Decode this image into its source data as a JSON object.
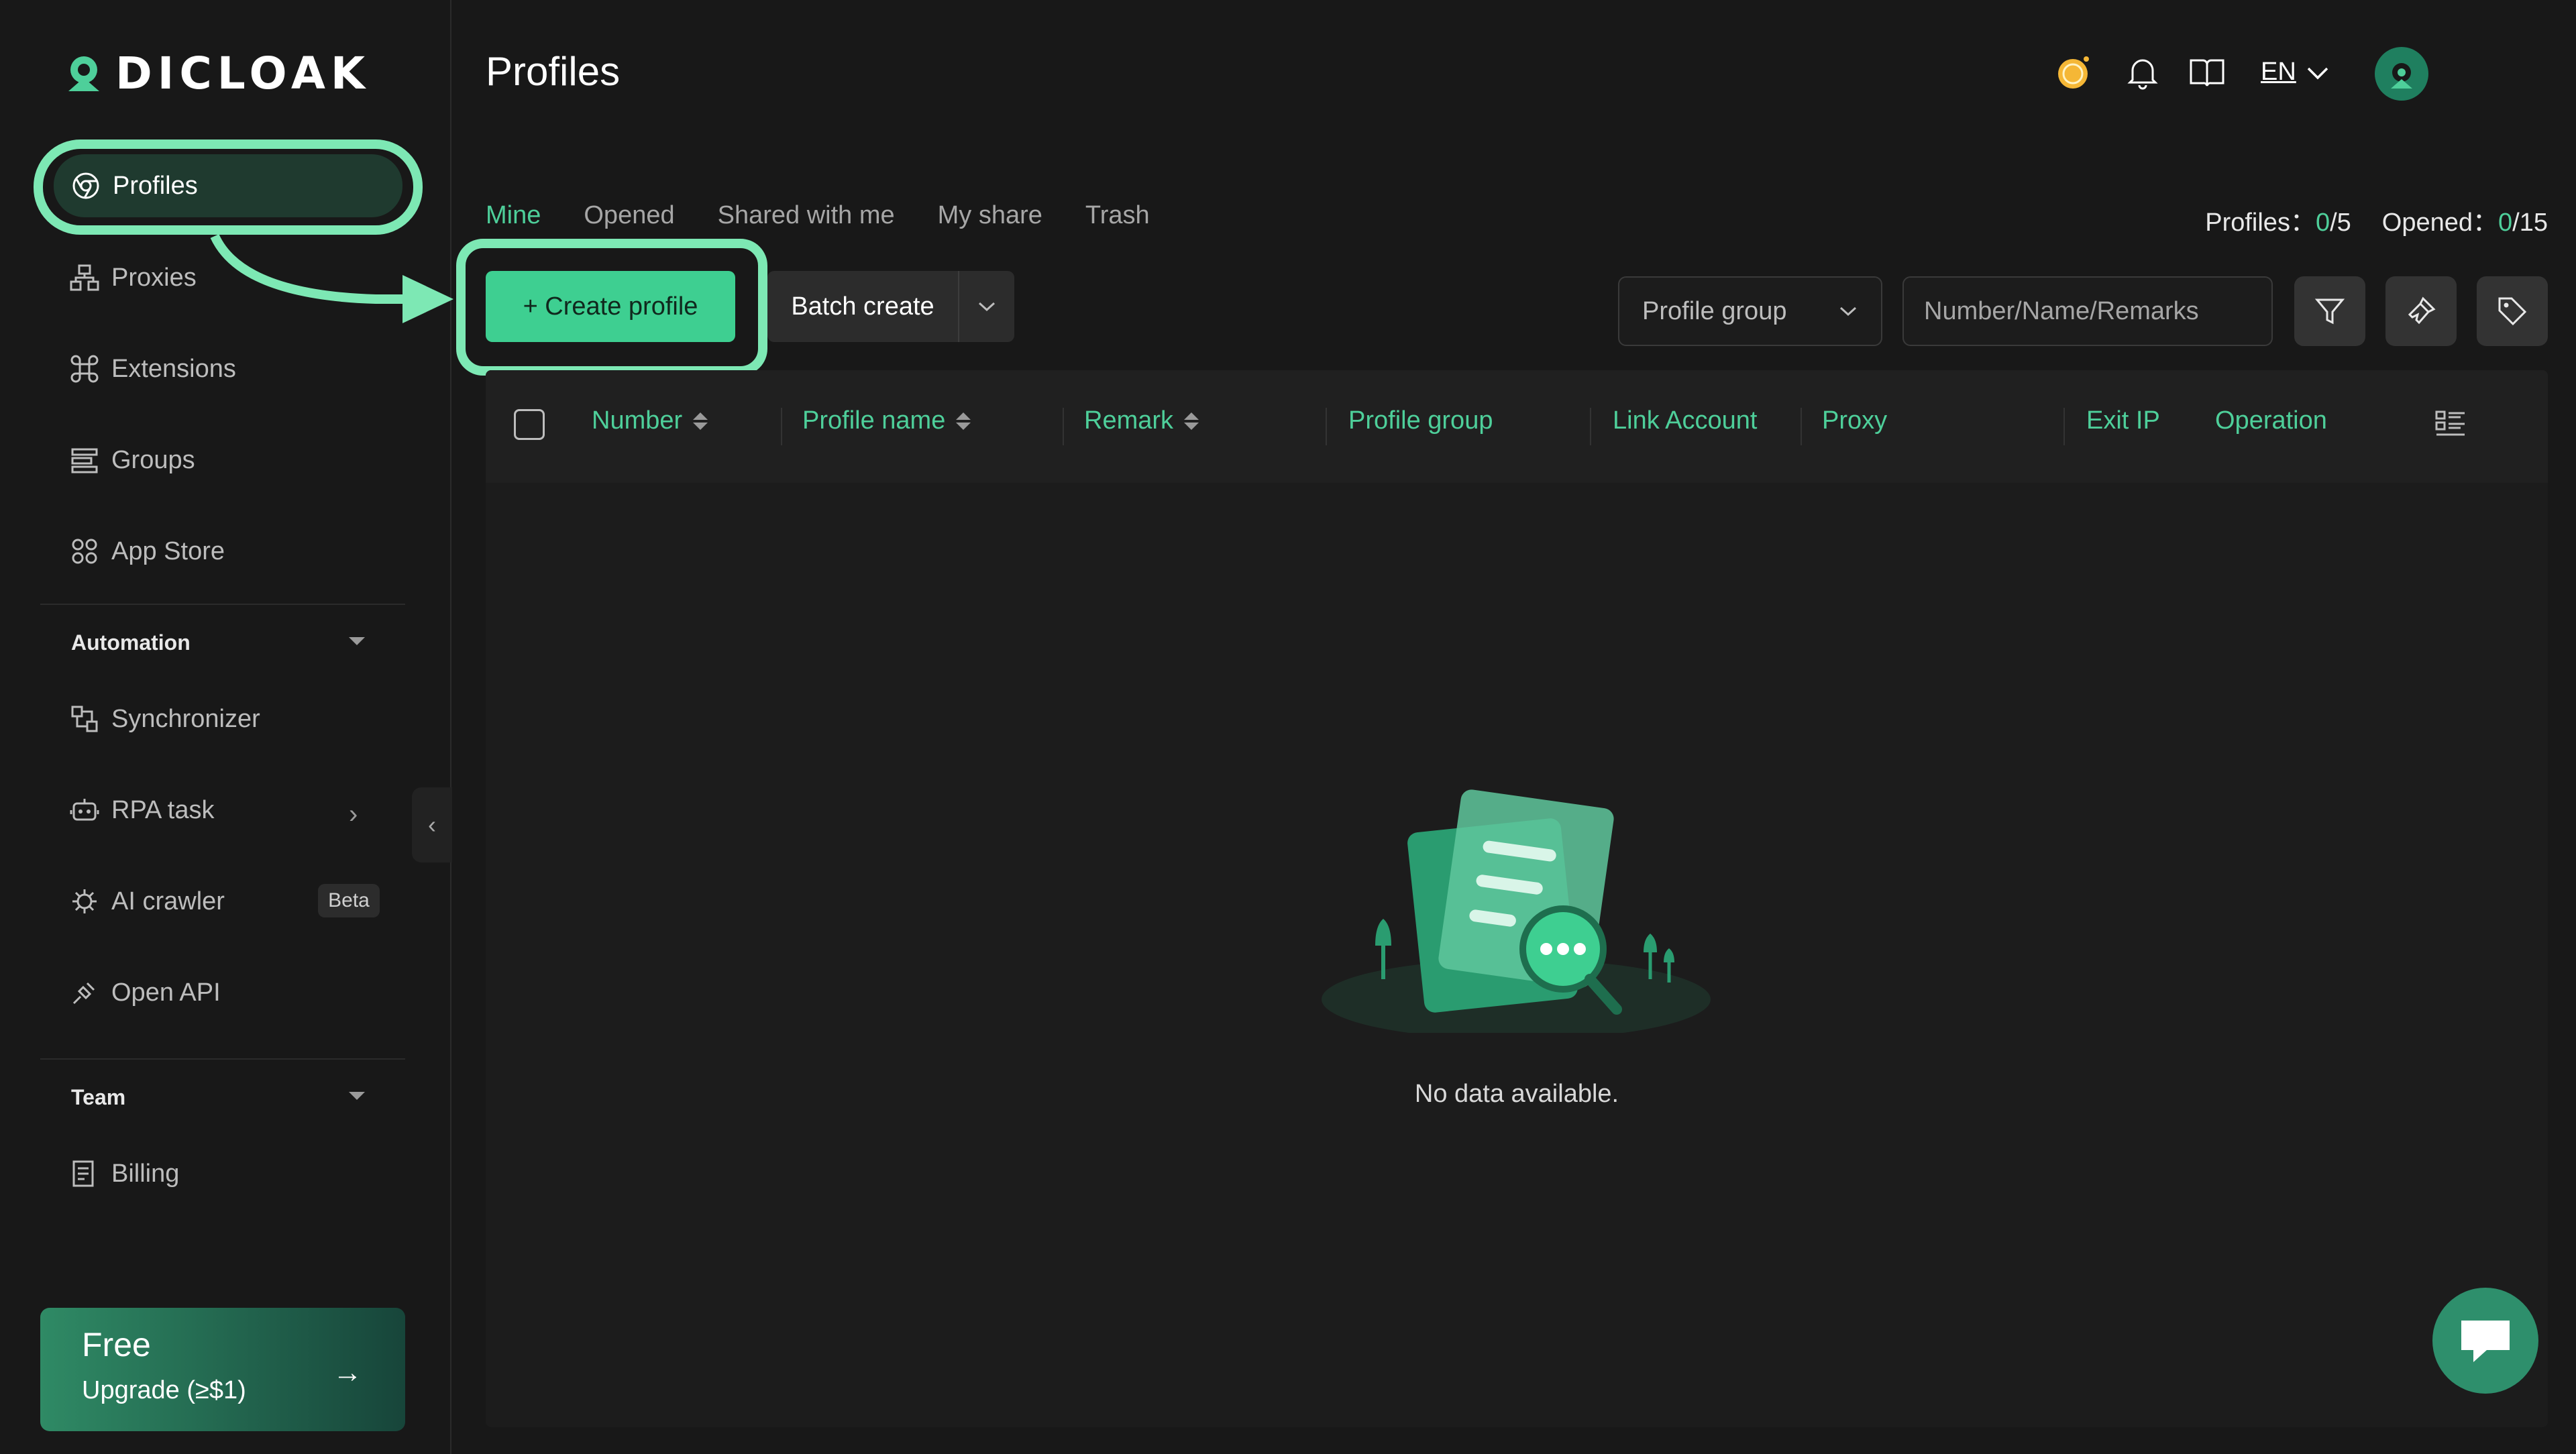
{
  "app": {
    "logo_text": "DICLOAK",
    "page_title": "Profiles"
  },
  "sidebar": {
    "items": [
      {
        "label": "Profiles",
        "icon": "chrome-icon"
      },
      {
        "label": "Proxies",
        "icon": "network-icon"
      },
      {
        "label": "Extensions",
        "icon": "command-icon"
      },
      {
        "label": "Groups",
        "icon": "list-icon"
      },
      {
        "label": "App Store",
        "icon": "app-store-icon"
      }
    ],
    "automation": {
      "heading": "Automation",
      "items": [
        {
          "label": "Synchronizer",
          "icon": "sync-icon"
        },
        {
          "label": "RPA task",
          "icon": "robot-icon"
        },
        {
          "label": "AI crawler",
          "icon": "bug-icon",
          "badge": "Beta"
        },
        {
          "label": "Open API",
          "icon": "plug-icon"
        }
      ]
    },
    "team": {
      "heading": "Team",
      "items": [
        {
          "label": "Billing",
          "icon": "billing-icon"
        }
      ]
    },
    "upgrade": {
      "plan": "Free",
      "cta": "Upgrade (≥$1)",
      "arrow": "→"
    }
  },
  "header": {
    "language": "EN",
    "icons": [
      "coin-icon",
      "bell-icon",
      "book-icon",
      "avatar"
    ]
  },
  "tabs": [
    {
      "label": "Mine",
      "active": true
    },
    {
      "label": "Opened",
      "active": false
    },
    {
      "label": "Shared with me",
      "active": false
    },
    {
      "label": "My share",
      "active": false
    },
    {
      "label": "Trash",
      "active": false
    }
  ],
  "counts": {
    "profiles_label": "Profiles：",
    "profiles_current": "0",
    "profiles_total": "/5",
    "opened_label": "Opened：",
    "opened_current": "0",
    "opened_total": "/15"
  },
  "toolbar": {
    "create_label": "+ Create profile",
    "batch_label": "Batch create",
    "group_select": "Profile group",
    "search_placeholder": "Number/Name/Remarks"
  },
  "table": {
    "columns": [
      "Number",
      "Profile name",
      "Remark",
      "Profile group",
      "Link Account",
      "Proxy",
      "Exit IP",
      "Operation"
    ],
    "rows": [],
    "empty_text": "No data available."
  },
  "colors": {
    "accent": "#4ecf9a",
    "highlight": "#7de8b4",
    "background": "#181818"
  }
}
